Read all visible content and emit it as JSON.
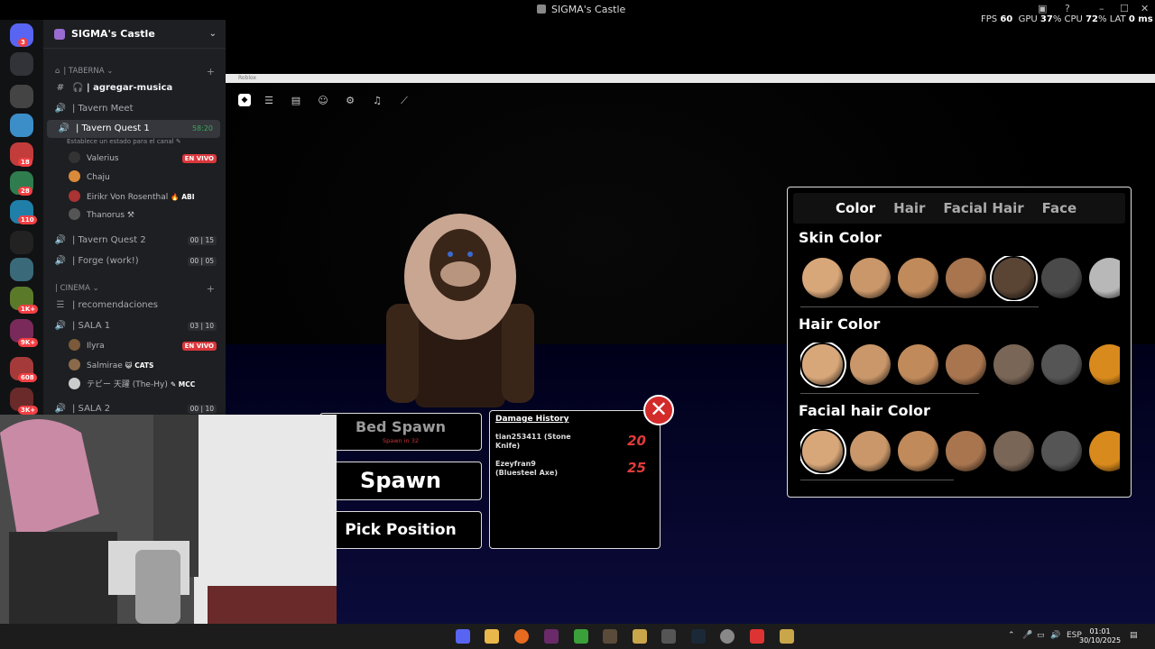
{
  "window": {
    "title": "SIGMA's Castle",
    "game_window_title": "Roblox"
  },
  "stats": {
    "fps_label": "FPS",
    "fps": "60",
    "gpu_label": "GPU",
    "gpu": "37",
    "cpu_label": "CPU",
    "cpu": "72",
    "lat_label": "LAT",
    "lat": "0 ms",
    "pct": "%"
  },
  "discord": {
    "rail_badges": [
      "3",
      "18",
      "28",
      "110",
      "1K+",
      "9K+",
      "608",
      "3K+"
    ],
    "guild_name": "SIGMA's Castle",
    "categories": {
      "taberna": "| TABERNA",
      "cinema": "| CINEMA"
    },
    "channels": {
      "agregar_musica": "| agregar-musica",
      "tavern_meet": "| Tavern Meet",
      "tavern_quest_1": "| Tavern Quest 1",
      "tavern_quest_1_time": "58:20",
      "status_placeholder": "Establece un estado para el canal",
      "tavern_quest_2": "| Tavern Quest 2",
      "tavern_quest_2_count": "00",
      "tavern_quest_2_limit": "15",
      "forge": "| Forge (work!)",
      "forge_count": "00",
      "forge_limit": "05",
      "recomendaciones": "| recomendaciones",
      "sala1": "| SALA 1",
      "sala1_count": "03",
      "sala1_limit": "10",
      "sala2": "| SALA 2",
      "sala2_count": "00",
      "sala2_limit": "10"
    },
    "members_quest": [
      {
        "name": "Valerius",
        "live": "EN VIVO",
        "tag": ""
      },
      {
        "name": "Chaju",
        "live": "",
        "tag": ""
      },
      {
        "name": "Eirikr Von Rosenthal",
        "live": "",
        "tag": "ABI"
      },
      {
        "name": "Thanorus",
        "live": "",
        "tag": ""
      }
    ],
    "members_sala": [
      {
        "name": "Ilyra",
        "live": "EN VIVO",
        "tag": ""
      },
      {
        "name": "Salmirae",
        "live": "",
        "tag": "CATS"
      },
      {
        "name": "テビー 天躍 (The-Hy)",
        "live": "",
        "tag": "MCC"
      }
    ]
  },
  "customize": {
    "tabs": [
      "Color",
      "Hair",
      "Facial Hair",
      "Face"
    ],
    "selected_tab": "Color",
    "sections": [
      {
        "title": "Skin Color",
        "colors": [
          "#d8a779",
          "#c9976a",
          "#c08a5b",
          "#a8754f",
          "#5a4434",
          "#4a4a4a",
          "#b8b8b8"
        ],
        "selected": 4
      },
      {
        "title": "Hair Color",
        "colors": [
          "#d8a779",
          "#c9976a",
          "#c08a5b",
          "#a8754f",
          "#7a6656",
          "#555555",
          "#d98a1c"
        ],
        "selected": 0
      },
      {
        "title": "Facial hair Color",
        "colors": [
          "#d8a779",
          "#c9976a",
          "#c08a5b",
          "#a8754f",
          "#7a6656",
          "#555555",
          "#d98a1c"
        ],
        "selected": 0
      }
    ]
  },
  "spawn_menu": {
    "bed_spawn": "Bed Spawn",
    "bed_sub": "Spawn in 32",
    "spawn": "Spawn",
    "pick": "Pick Position"
  },
  "damage": {
    "title": "Damage History",
    "entries": [
      {
        "who": "tian253411 (Stone Knife)",
        "value": "20"
      },
      {
        "who": "Ezeyfran9 (Bluesteel Axe)",
        "value": "25"
      }
    ],
    "close": "✕"
  },
  "taskbar": {
    "lang": "ESP",
    "time": "01:01",
    "date": "30/10/2025"
  }
}
